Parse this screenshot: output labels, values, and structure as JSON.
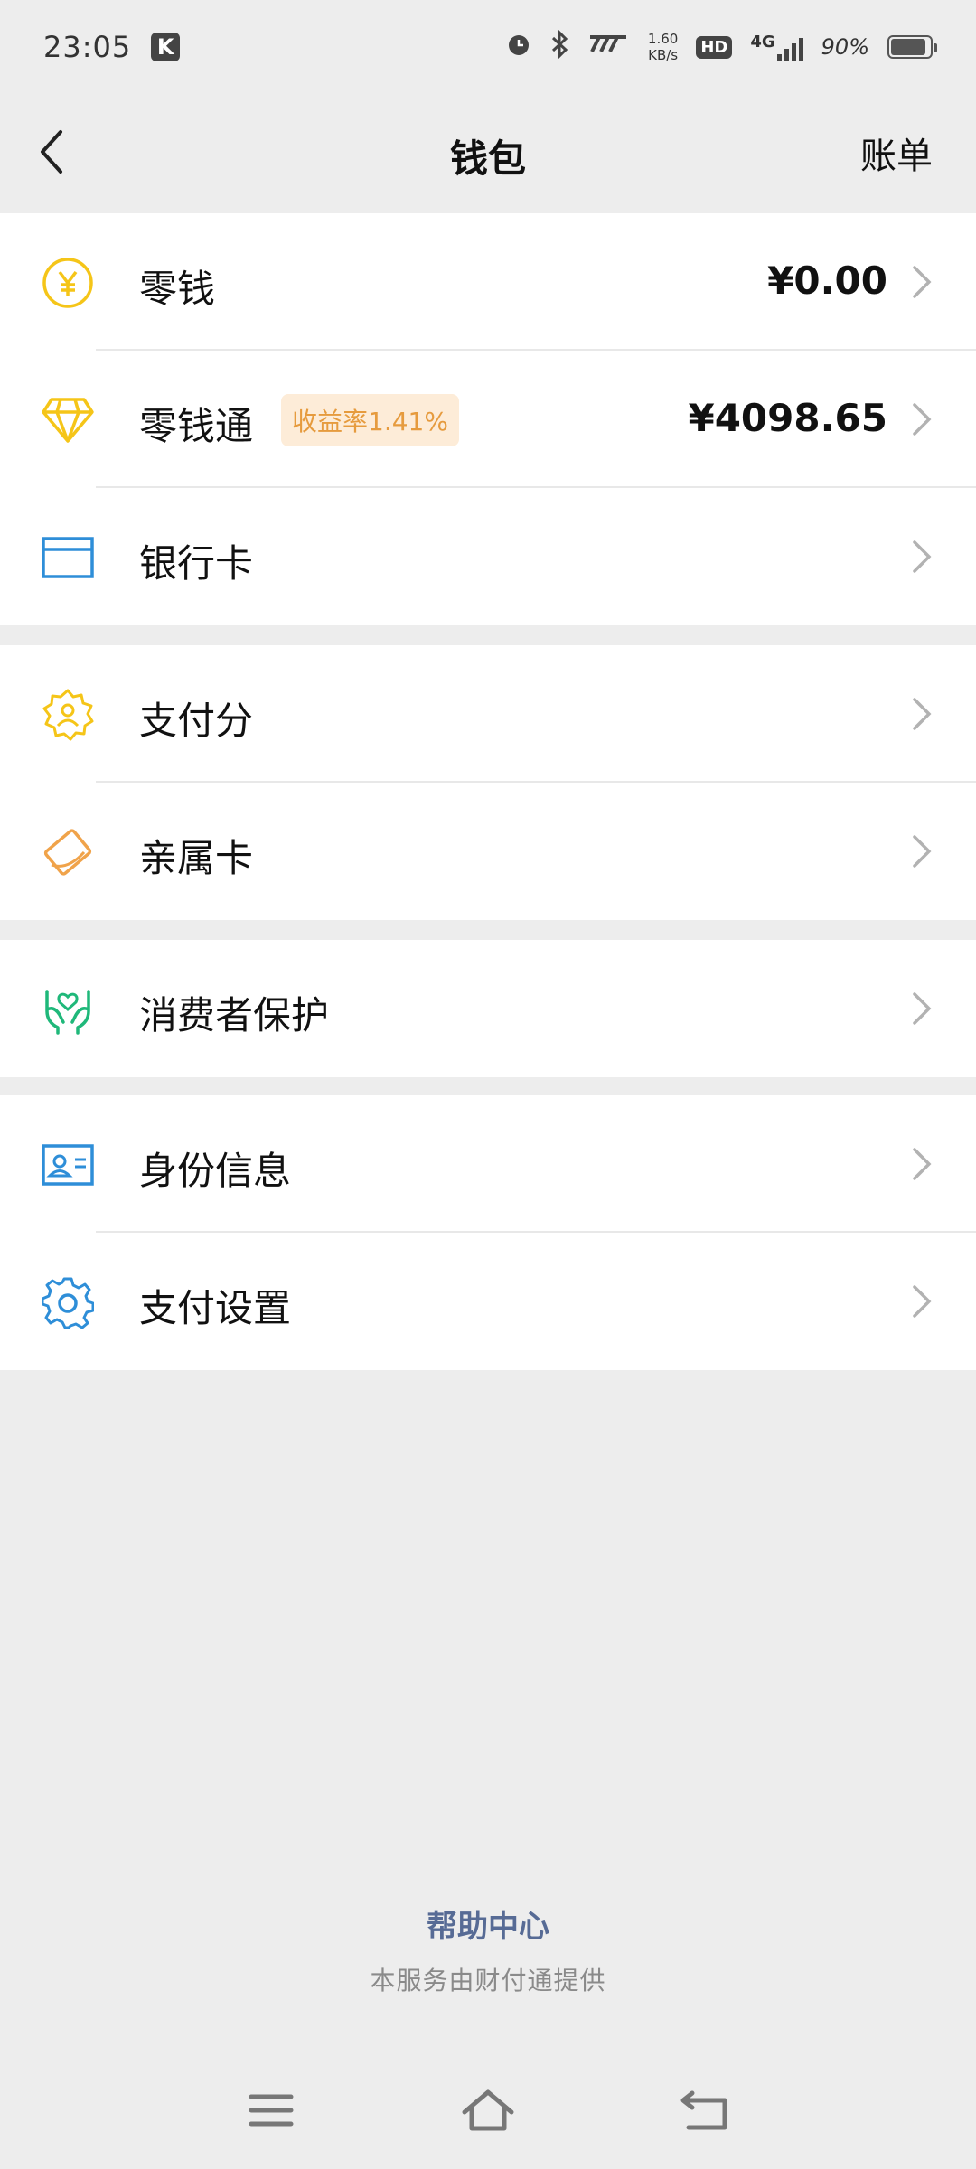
{
  "status_bar": {
    "time": "23:05",
    "app_badge": "K",
    "net_speed_value": "1.60",
    "net_speed_unit": "KB/s",
    "hd_label": "HD",
    "network_label": "4G",
    "battery_percent": "90%",
    "battery_level": 0.9
  },
  "nav": {
    "title": "钱包",
    "action_label": "账单"
  },
  "groups": [
    {
      "items": [
        {
          "label": "零钱",
          "value": "¥0.00",
          "icon": "yuan-coin-icon",
          "color": "#f5c518"
        },
        {
          "label": "零钱通",
          "badge": "收益率1.41%",
          "value": "¥4098.65",
          "icon": "diamond-icon",
          "color": "#f5c518"
        },
        {
          "label": "银行卡",
          "icon": "bank-card-icon",
          "color": "#2e8ed8"
        }
      ]
    },
    {
      "items": [
        {
          "label": "支付分",
          "icon": "pay-score-icon",
          "color": "#f5c518"
        },
        {
          "label": "亲属卡",
          "icon": "family-card-icon",
          "color": "#f0a34a"
        }
      ]
    },
    {
      "items": [
        {
          "label": "消费者保护",
          "icon": "consumer-protection-icon",
          "color": "#1fb87a"
        }
      ]
    },
    {
      "items": [
        {
          "label": "身份信息",
          "icon": "id-card-icon",
          "color": "#2e8ed8"
        },
        {
          "label": "支付设置",
          "icon": "gear-icon",
          "color": "#2e8ed8"
        }
      ]
    }
  ],
  "footer": {
    "help_link": "帮助中心",
    "note": "本服务由财付通提供"
  },
  "colors": {
    "background": "#ededed",
    "link": "#576b95",
    "badge_bg": "#fdecd8",
    "badge_text": "#e69b3e"
  }
}
